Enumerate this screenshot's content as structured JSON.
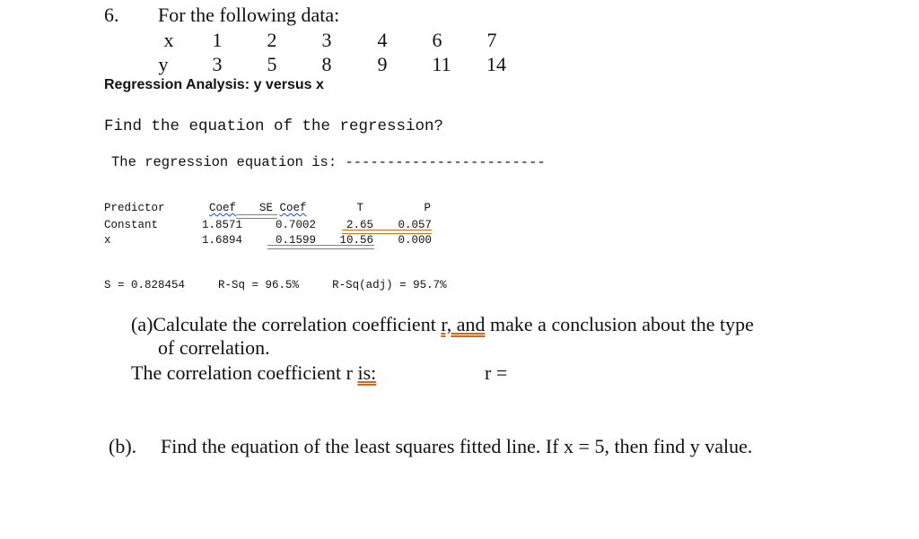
{
  "question": {
    "number": "6.",
    "heading": "For the following data:"
  },
  "data_table": {
    "x_label": "x",
    "y_label": "y",
    "x_values": [
      "1",
      "2",
      "3",
      "4",
      "6",
      "7"
    ],
    "y_values": [
      "3",
      "5",
      "8",
      "9",
      "11",
      "14"
    ]
  },
  "regression_title": "Regression Analysis: y versus x",
  "find_equation_prompt": "Find the equation of the regression?",
  "regression_equation_line": "The regression equation is: ------------------------",
  "coef_table": {
    "headers": {
      "predictor": "Predictor",
      "coef": "Coef",
      "se_coef": "SE Coef",
      "t": "T",
      "p": "P"
    },
    "rows": [
      {
        "predictor": "Constant",
        "coef": "1.8571",
        "se_coef": "0.7002",
        "t": "2.65",
        "p": "0.057"
      },
      {
        "predictor": "x",
        "coef": "1.6894",
        "se_coef": "0.1599",
        "t": "10.56",
        "p": "0.000"
      }
    ]
  },
  "fit_stats": {
    "s": "S = 0.828454",
    "rsq": "R-Sq = 96.5%",
    "rsq_adj": "R-Sq(adj) = 95.7%"
  },
  "part_a": {
    "label": "(a)",
    "text_before": "Calculate the correlation coefficient ",
    "text_underlined": "r, and",
    "text_after": " make a conclusion about the type",
    "text_line2": "of correlation.",
    "answer_prefix": "The correlation coefficient r ",
    "answer_underlined": "is:",
    "r_equals": "r ="
  },
  "part_b": {
    "label": "(b).",
    "text": "Find the equation of the least squares fitted line. If x = 5, then find y value."
  }
}
